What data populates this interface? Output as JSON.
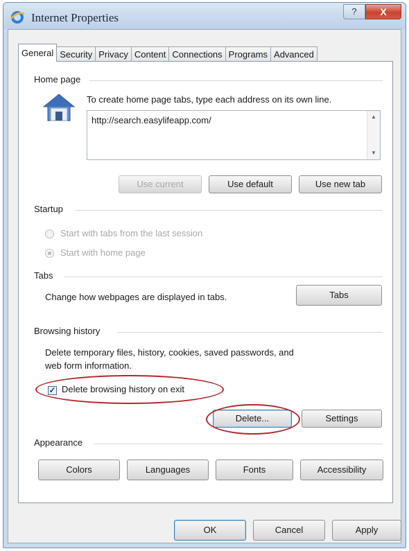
{
  "window": {
    "title": "Internet Properties",
    "help_glyph": "?",
    "close_glyph": "X"
  },
  "tabs": [
    "General",
    "Security",
    "Privacy",
    "Content",
    "Connections",
    "Programs",
    "Advanced"
  ],
  "home_page": {
    "group_title": "Home page",
    "instruction": "To create home page tabs, type each address on its own line.",
    "url_value": "http://search.easylifeapp.com/",
    "use_current": "Use current",
    "use_default": "Use default",
    "use_new_tab": "Use new tab"
  },
  "startup": {
    "group_title": "Startup",
    "option_last_session": "Start with tabs from the last session",
    "option_home_page": "Start with home page",
    "selected": "Start with home page"
  },
  "tabs_group": {
    "group_title": "Tabs",
    "description": "Change how webpages are displayed in tabs.",
    "button": "Tabs"
  },
  "browsing_history": {
    "group_title": "Browsing history",
    "description_line1": "Delete temporary files, history, cookies, saved passwords, and",
    "description_line2": "web form information.",
    "delete_on_exit_label": "Delete browsing history on exit",
    "delete_on_exit_checked": true,
    "delete_button": "Delete...",
    "settings_button": "Settings"
  },
  "appearance": {
    "group_title": "Appearance",
    "colors": "Colors",
    "languages": "Languages",
    "fonts": "Fonts",
    "accessibility": "Accessibility"
  },
  "footer": {
    "ok": "OK",
    "cancel": "Cancel",
    "apply": "Apply"
  },
  "colors": {
    "annotation_red": "#b3282c",
    "title_bar": "#c9d9ec",
    "close_red": "#c8432e"
  }
}
